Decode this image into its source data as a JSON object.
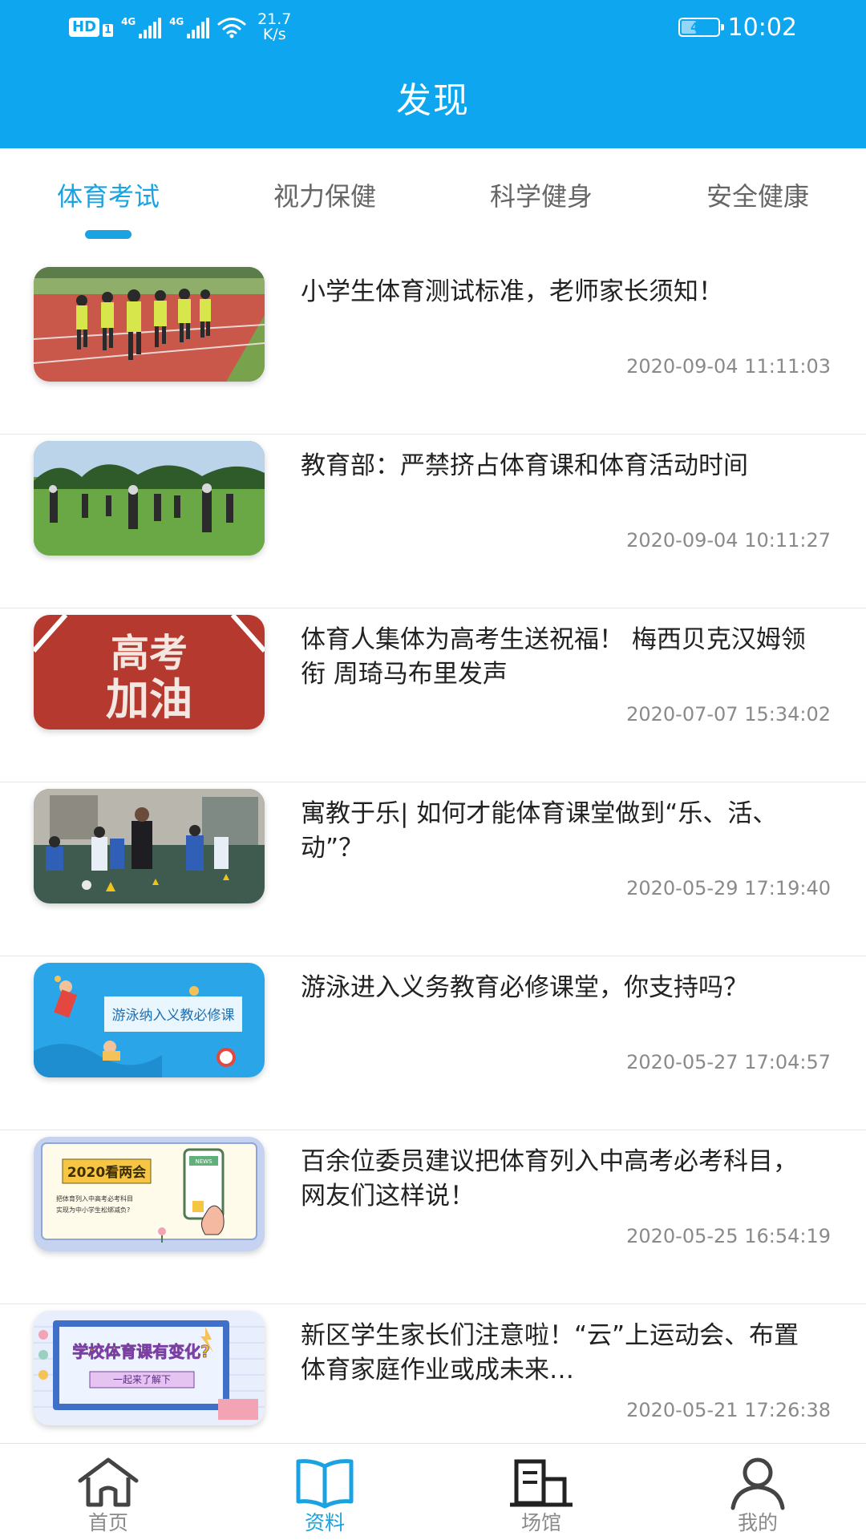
{
  "status_bar": {
    "hd_badge": "HD",
    "sim_index": "1",
    "network_1": "4G",
    "network_2": "4G",
    "speed_value": "21.7",
    "speed_unit": "K/s",
    "battery": "41",
    "battery_level": 0.41,
    "time": "10:02"
  },
  "header": {
    "title": "发现"
  },
  "tabs": [
    {
      "label": "体育考试",
      "active": true
    },
    {
      "label": "视力保健",
      "active": false
    },
    {
      "label": "科学健身",
      "active": false
    },
    {
      "label": "安全健康",
      "active": false
    }
  ],
  "articles": [
    {
      "title": "小学生体育测试标准，老师家长须知！",
      "date": "2020-09-04 11:11:03",
      "thumb": "track-running-kids"
    },
    {
      "title": "教育部：严禁挤占体育课和体育活动时间",
      "date": "2020-09-04 10:11:27",
      "thumb": "grass-field-class"
    },
    {
      "title": "体育人集体为高考生送祝福！ 梅西贝克汉姆领衔 周琦马布里发声",
      "date": "2020-07-07 15:34:02",
      "thumb": "gaokao-jiayou-track"
    },
    {
      "title": "寓教于乐| 如何才能体育课堂做到“乐、活、动”？",
      "date": "2020-05-29 17:19:40",
      "thumb": "football-drill-class"
    },
    {
      "title": "游泳进入义务教育必修课堂，你支持吗？",
      "date": "2020-05-27 17:04:57",
      "thumb": "swimming-illustration"
    },
    {
      "title": "百余位委员建议把体育列入中高考必考科目，网友们这样说！",
      "date": "2020-05-25 16:54:19",
      "thumb": "two-sessions-illustration"
    },
    {
      "title": "新区学生家长们注意啦！“云”上运动会、布置体育家庭作业或成未来…",
      "date": "2020-05-21 17:26:38",
      "thumb": "pe-class-change-illustration"
    }
  ],
  "thumb_text": {
    "gaokao_line1": "高考",
    "gaokao_line2": "加油",
    "swim_banner": "游泳纳入义教必修课",
    "two_sessions_title": "2020看两会",
    "two_sessions_sub1": "把体育列入中高考必考科目",
    "two_sessions_sub2": "实现为中小学生松绑减负?",
    "news_tag": "NEWS",
    "pe_change_title": "学校体育课有变化?",
    "pe_change_button": "一起来了解下"
  },
  "bottom_nav": [
    {
      "label": "首页",
      "icon": "home-icon",
      "active": false
    },
    {
      "label": "资料",
      "icon": "book-icon",
      "active": true
    },
    {
      "label": "场馆",
      "icon": "venue-building-icon",
      "active": false
    },
    {
      "label": "我的",
      "icon": "user-icon",
      "active": false
    }
  ],
  "colors": {
    "primary": "#0ea6ee",
    "accent": "#1aa3e0",
    "text": "#222222",
    "muted": "#8a8a8a",
    "track_red": "#b5392f"
  }
}
